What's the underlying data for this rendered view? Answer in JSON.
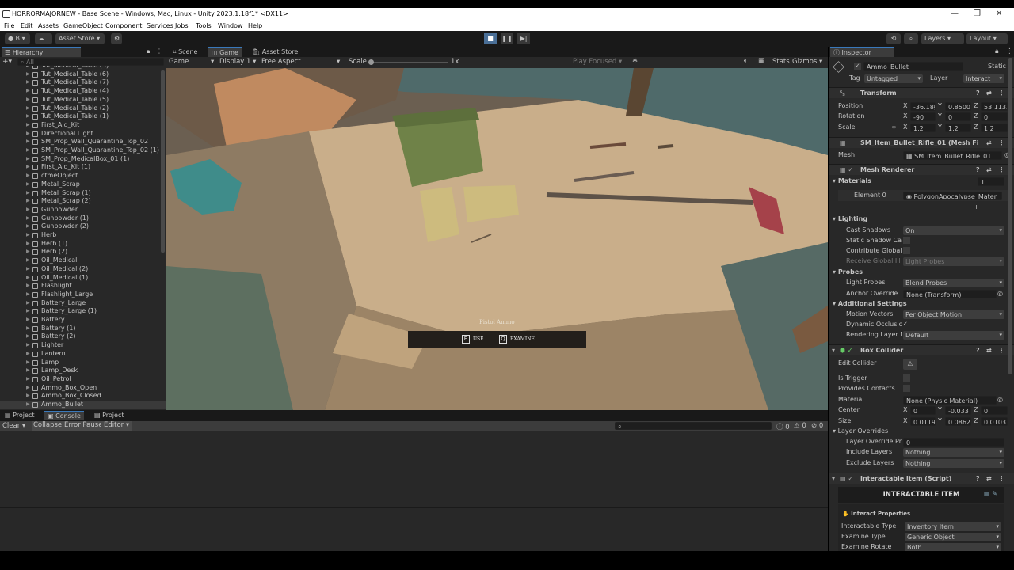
{
  "window": {
    "title": "HORRORMAJORNEW - Base Scene - Windows, Mac, Linux - Unity 2023.1.18f1* <DX11>",
    "minimize": "—",
    "maximize": "❐",
    "close": "✕"
  },
  "menu": [
    "File",
    "Edit",
    "Assets",
    "GameObject",
    "Component",
    "Services",
    "Jobs",
    "Tools",
    "Window",
    "Help"
  ],
  "toolbar": {
    "account": "B",
    "asset_store": "Asset Store",
    "layers": "Layers",
    "layout": "Layout"
  },
  "hierarchy": {
    "title": "Hierarchy",
    "search_placeholder": "All",
    "items": [
      "Tut_Medical_Table (5)",
      "Tut_Medical_Table (6)",
      "Tut_Medical_Table (7)",
      "Tut_Medical_Table (4)",
      "Tut_Medical_Table (5)",
      "Tut_Medical_Table (2)",
      "Tut_Medical_Table (1)",
      "First_Aid_Kit",
      "Directional Light",
      "SM_Prop_Wall_Quarantine_Top_02",
      "SM_Prop_Wall_Quarantine_Top_02 (1)",
      "SM_Prop_MedicalBox_01 (1)",
      "First_Aid_Kit (1)",
      "ctmeObject",
      "Metal_Scrap",
      "Metal_Scrap (1)",
      "Metal_Scrap (2)",
      "Gunpowder",
      "Gunpowder (1)",
      "Gunpowder (2)",
      "Herb",
      "Herb (1)",
      "Herb (2)",
      "Oil_Medical",
      "Oil_Medical (2)",
      "Oil_Medical (1)",
      "Flashlight",
      "Flashlight_Large",
      "Battery_Large",
      "Battery_Large (1)",
      "Battery",
      "Battery (1)",
      "Battery (2)",
      "Lighter",
      "Lantern",
      "Lamp",
      "Lamp_Desk",
      "Oil_Petrol",
      "Ammo_Box_Open",
      "Ammo_Box_Closed",
      "Ammo_Bullet"
    ]
  },
  "game": {
    "tabs": [
      "Scene",
      "Game",
      "Asset Store"
    ],
    "mode": "Game",
    "display": "Display 1",
    "aspect": "Free Aspect",
    "scale_label": "Scale",
    "scale_value": "1x",
    "play_focused": "Play Focused",
    "stats": "Stats",
    "gizmos": "Gizmos",
    "prompt": {
      "title": "Pistol Ammo",
      "use_key": "E",
      "use": "USE",
      "examine_key": "Q",
      "examine": "EXAMINE"
    }
  },
  "console": {
    "tabs": [
      "Project",
      "Console",
      "Project"
    ],
    "clear": "Clear",
    "collapse": "Collapse",
    "error_pause": "Error Pause",
    "editor": "Editor",
    "counts": [
      "0",
      "0",
      "0"
    ]
  },
  "inspector": {
    "title": "Inspector",
    "object_name": "Ammo_Bullet",
    "static": "Static",
    "tag_label": "Tag",
    "tag": "Untagged",
    "layer_label": "Layer",
    "layer": "Interact",
    "transform": {
      "title": "Transform",
      "position_label": "Position",
      "position": [
        "-36.18§",
        "0.8500",
        "53.1133"
      ],
      "rotation_label": "Rotation",
      "rotation": [
        "-90",
        "0",
        "0"
      ],
      "scale_label": "Scale",
      "scale": [
        "1.2",
        "1.2",
        "1.2"
      ]
    },
    "mesh_filter": {
      "title": "SM_Item_Bullet_Rifle_01 (Mesh Fi",
      "mesh_label": "Mesh",
      "mesh": "SM_Item_Bullet_Rifle_01"
    },
    "mesh_renderer": {
      "title": "Mesh Renderer",
      "materials": "Materials",
      "materials_count": "1",
      "element0_label": "Element 0",
      "element0": "PolygonApocalypse_Mater",
      "lighting": "Lighting",
      "cast_shadows_label": "Cast Shadows",
      "cast_shadows": "On",
      "static_shadow": "Static Shadow Cas",
      "contribute_gi": "Contribute Global",
      "receive_gi_label": "Receive Global Ill",
      "receive_gi": "Light Probes",
      "probes": "Probes",
      "light_probes_label": "Light Probes",
      "light_probes": "Blend Probes",
      "anchor_label": "Anchor Override",
      "anchor": "None (Transform)",
      "additional": "Additional Settings",
      "motion_label": "Motion Vectors",
      "motion": "Per Object Motion",
      "dyn_occ": "Dynamic Occlusion",
      "rendering_label": "Rendering Layer M",
      "rendering": "Default"
    },
    "box_collider": {
      "title": "Box Collider",
      "edit_collider": "Edit Collider",
      "is_trigger": "Is Trigger",
      "provides_contacts": "Provides Contacts",
      "material_label": "Material",
      "material": "None (Physic Material)",
      "center_label": "Center",
      "center": [
        "0",
        "-0.033",
        "0"
      ],
      "size_label": "Size",
      "size": [
        "0.0119(",
        "0.0862",
        "0.0103"
      ],
      "layer_overrides": "Layer Overrides",
      "lop_label": "Layer Override Pri",
      "lop": "0",
      "include_label": "Include Layers",
      "include": "Nothing",
      "exclude_label": "Exclude Layers",
      "exclude": "Nothing"
    },
    "script": {
      "title": "Interactable Item (Script)",
      "banner": "INTERACTABLE ITEM",
      "props": "Interact Properties",
      "type_label": "Interactable Type",
      "type": "Inventory Item",
      "examine_label": "Examine Type",
      "examine": "Generic Object",
      "rotate_label": "Examine Rotate",
      "rotate": "Both"
    }
  }
}
